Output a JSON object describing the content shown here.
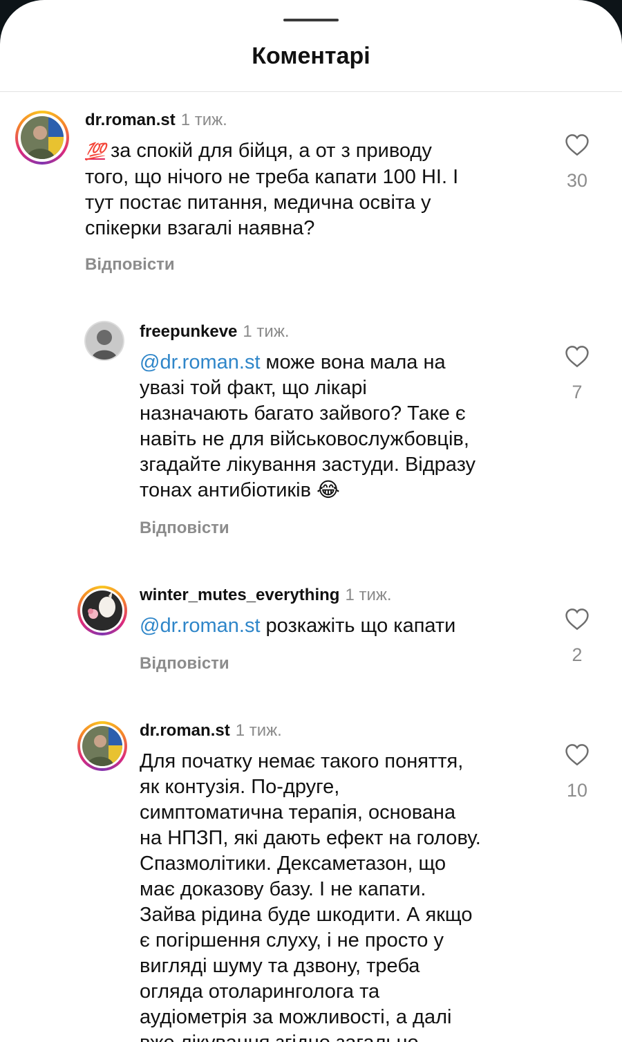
{
  "header": {
    "title": "Коментарі"
  },
  "comments": [
    {
      "username": "dr.roman.st",
      "time": "1 тиж.",
      "emoji": "💯",
      "text": " за спокій для бійця, а от з приводу\nтого, що нічого не треба капати 100 НІ. І\nтут постає питання, медична освіта у\nспікерки взагалі наявна?",
      "reply_label": "Відповісти",
      "likes": "30"
    },
    {
      "username": "freepunkeve",
      "time": "1 тиж.",
      "mention": "@dr.roman.st",
      "text": " може вона мала на\nувазі той факт, що лікарі\nназначають багато зайвого? Таке є\nнавіть не для військовослужбовців,\nзгадайте лікування застуди. Відразу\nтонах антибіотиків ",
      "emoji": "😂",
      "reply_label": "Відповісти",
      "likes": "7"
    },
    {
      "username": "winter_mutes_everything",
      "time": "1 тиж.",
      "mention": "@dr.roman.st",
      "text": " розкажіть що капати",
      "reply_label": "Відповісти",
      "likes": "2"
    },
    {
      "username": "dr.roman.st",
      "time": "1 тиж.",
      "text": "Для початку немає такого поняття,\nяк контузія. По-друге,\nсимптоматична терапія, основана\nна НПЗП, які дають ефект на голову.\nСпазмолітики. Дексаметазон, що\nмає доказову базу. І не капати.\nЗайва рідина буде шкодити. А якщо\nє погіршення слуху, і не просто у\nвигляді шуму та дзвону, треба\nогляда отоларинголога та\nаудіометрія за можливості, а далі\nвже лікування згідно загально",
      "likes": "10"
    }
  ]
}
